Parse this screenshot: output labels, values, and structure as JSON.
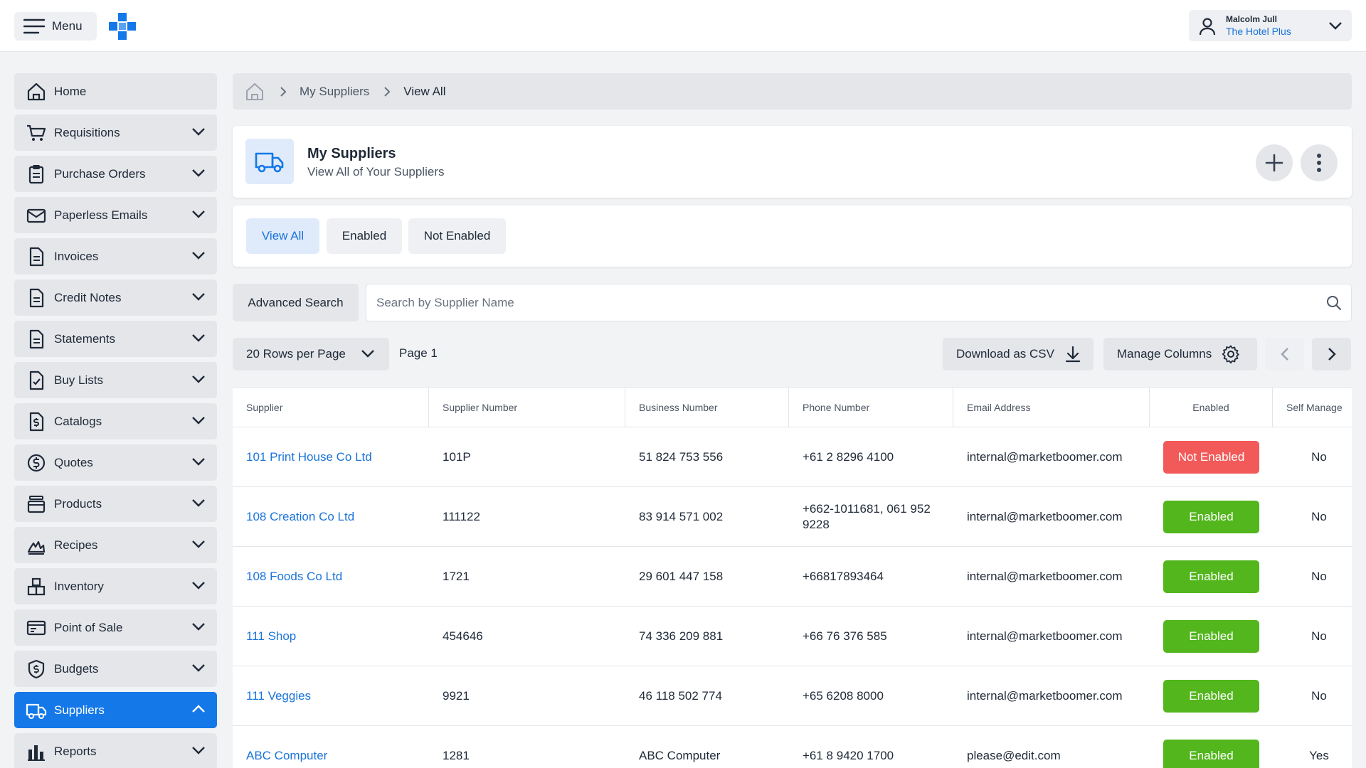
{
  "header": {
    "menu_label": "Menu",
    "user_name": "Malcolm Jull",
    "user_org": "The Hotel Plus"
  },
  "sidebar": {
    "items": [
      {
        "label": "Home",
        "icon": "home-icon",
        "active": false,
        "chevron": "none"
      },
      {
        "label": "Requisitions",
        "icon": "cart-icon",
        "active": false,
        "chevron": "down"
      },
      {
        "label": "Purchase Orders",
        "icon": "clipboard-icon",
        "active": false,
        "chevron": "down"
      },
      {
        "label": "Paperless Emails",
        "icon": "envelope-icon",
        "active": false,
        "chevron": "down"
      },
      {
        "label": "Invoices",
        "icon": "document-icon",
        "active": false,
        "chevron": "down"
      },
      {
        "label": "Credit Notes",
        "icon": "document-icon",
        "active": false,
        "chevron": "down"
      },
      {
        "label": "Statements",
        "icon": "document-icon",
        "active": false,
        "chevron": "down"
      },
      {
        "label": "Buy Lists",
        "icon": "checklist-icon",
        "active": false,
        "chevron": "down"
      },
      {
        "label": "Catalogs",
        "icon": "dollar-document-icon",
        "active": false,
        "chevron": "down"
      },
      {
        "label": "Quotes",
        "icon": "dollar-circle-icon",
        "active": false,
        "chevron": "down"
      },
      {
        "label": "Products",
        "icon": "products-icon",
        "active": false,
        "chevron": "down"
      },
      {
        "label": "Recipes",
        "icon": "recipe-flame-icon",
        "active": false,
        "chevron": "down"
      },
      {
        "label": "Inventory",
        "icon": "boxes-icon",
        "active": false,
        "chevron": "down"
      },
      {
        "label": "Point of Sale",
        "icon": "pos-card-icon",
        "active": false,
        "chevron": "down"
      },
      {
        "label": "Budgets",
        "icon": "shield-dollar-icon",
        "active": false,
        "chevron": "down"
      },
      {
        "label": "Suppliers",
        "icon": "truck-icon",
        "active": true,
        "chevron": "up"
      },
      {
        "label": "Reports",
        "icon": "bar-chart-icon",
        "active": false,
        "chevron": "down"
      }
    ]
  },
  "breadcrumb": {
    "items": [
      "My Suppliers",
      "View All"
    ]
  },
  "page": {
    "title": "My Suppliers",
    "subtitle": "View All of Your Suppliers"
  },
  "tabs": [
    {
      "label": "View All",
      "active": true
    },
    {
      "label": "Enabled",
      "active": false
    },
    {
      "label": "Not Enabled",
      "active": false
    }
  ],
  "search": {
    "advanced_label": "Advanced Search",
    "placeholder": "Search by Supplier Name"
  },
  "toolbar": {
    "rows_per_page": "20 Rows per Page",
    "page_label": "Page 1",
    "download_label": "Download as CSV",
    "manage_columns_label": "Manage Columns"
  },
  "colors": {
    "accent": "#1478e8",
    "link": "#1a73d9",
    "enabled": "#52b61c",
    "not_enabled": "#f25a5a"
  },
  "table": {
    "columns": [
      "Supplier",
      "Supplier Number",
      "Business Number",
      "Phone Number",
      "Email Address",
      "Enabled",
      "Self Manage"
    ],
    "rows": [
      {
        "supplier": "101 Print House Co Ltd",
        "supplier_number": "101P",
        "business_number": "51 824 753 556",
        "phone": "+61 2 8296 4100",
        "email": "internal@marketboomer.com",
        "status": "Not Enabled",
        "enabled": false,
        "self_managed": "No"
      },
      {
        "supplier": "108 Creation Co Ltd",
        "supplier_number": "111122",
        "business_number": "83 914 571 002",
        "phone": "+662-1011681, 061 952 9228",
        "email": "internal@marketboomer.com",
        "status": "Enabled",
        "enabled": true,
        "self_managed": "No"
      },
      {
        "supplier": "108 Foods Co Ltd",
        "supplier_number": "1721",
        "business_number": "29 601 447 158",
        "phone": "+66817893464",
        "email": "internal@marketboomer.com",
        "status": "Enabled",
        "enabled": true,
        "self_managed": "No"
      },
      {
        "supplier": "111 Shop",
        "supplier_number": "454646",
        "business_number": "74 336 209 881",
        "phone": "+66 76 376 585",
        "email": "internal@marketboomer.com",
        "status": "Enabled",
        "enabled": true,
        "self_managed": "No"
      },
      {
        "supplier": "111 Veggies",
        "supplier_number": "9921",
        "business_number": "46 118 502 774",
        "phone": "+65 6208 8000",
        "email": "internal@marketboomer.com",
        "status": "Enabled",
        "enabled": true,
        "self_managed": "No"
      },
      {
        "supplier": "ABC Computer",
        "supplier_number": "1281",
        "business_number": "ABC Computer",
        "phone": "+61 8 9420 1700",
        "email": "please@edit.com",
        "status": "Enabled",
        "enabled": true,
        "self_managed": "Yes"
      }
    ]
  }
}
